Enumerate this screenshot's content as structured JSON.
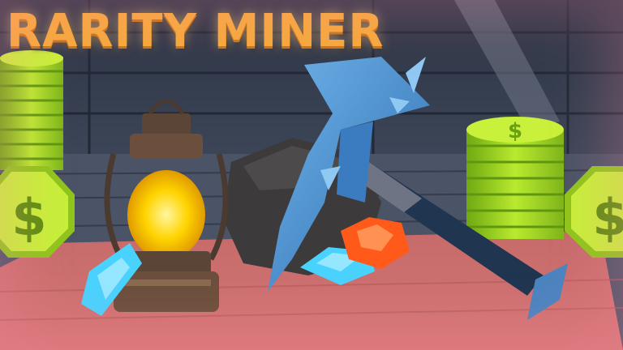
{
  "game": {
    "title": "RARITY MINER"
  },
  "icons": {
    "coin": "dollar-coin-icon",
    "pickaxe": "pickaxe-icon",
    "lantern": "lantern-icon",
    "gem": "gem-icon",
    "rock": "rock-icon"
  },
  "colors": {
    "title": "#f6a93b",
    "coin": "#b8e62e",
    "gem_blue": "#4ad2ff",
    "gem_orange": "#ff5a1a",
    "rug": "#c9605f",
    "pickaxe": "#3f86c9"
  }
}
